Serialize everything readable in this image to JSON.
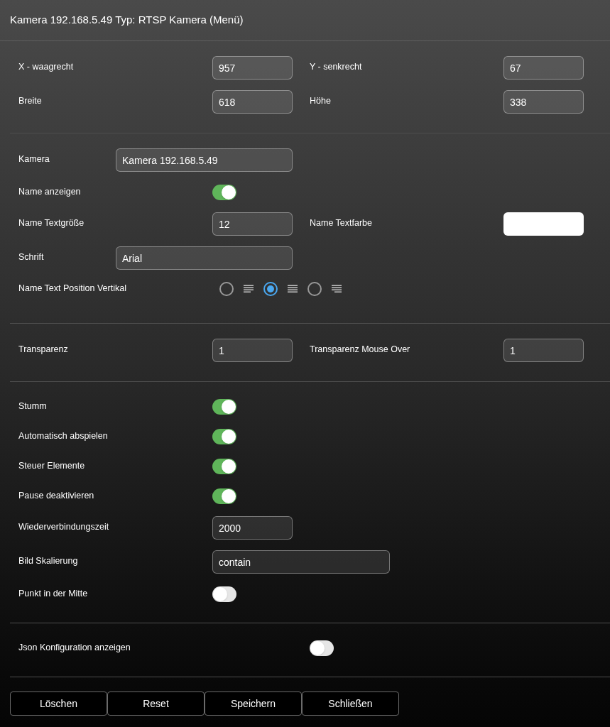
{
  "title": "Kamera 192.168.5.49 Typ: RTSP Kamera (Menü)",
  "sections": [
    {
      "rows": [
        [
          {
            "kind": "number",
            "label": "X - waagrecht",
            "value": "957"
          },
          {
            "kind": "number",
            "label": "Y - senkrecht",
            "value": "67"
          }
        ],
        [
          {
            "kind": "number",
            "label": "Breite",
            "value": "618"
          },
          {
            "kind": "number",
            "label": "Höhe",
            "value": "338"
          }
        ]
      ]
    },
    {
      "rows": [
        [
          {
            "kind": "text",
            "label": "Kamera",
            "value": "Kamera 192.168.5.49"
          }
        ],
        [
          {
            "kind": "toggle",
            "label": "Name anzeigen",
            "on": true
          }
        ],
        [
          {
            "kind": "number",
            "label": "Name Textgröße",
            "value": "12"
          },
          {
            "kind": "color",
            "label": "Name Textfarbe",
            "color": "#ffffff"
          }
        ],
        [
          {
            "kind": "text",
            "label": "Schrift",
            "value": "Arial"
          }
        ],
        [
          {
            "kind": "radio",
            "label": "Name Text Position Vertikal",
            "options": [
              {
                "selected": false
              },
              {
                "selected": true
              },
              {
                "selected": false
              }
            ]
          }
        ]
      ]
    },
    {
      "rows": [
        [
          {
            "kind": "number",
            "label": "Transparenz",
            "value": "1"
          },
          {
            "kind": "number",
            "label": "Transparenz Mouse Over",
            "value": "1"
          }
        ]
      ]
    },
    {
      "rows": [
        [
          {
            "kind": "toggle",
            "label": "Stumm",
            "on": true
          }
        ],
        [
          {
            "kind": "toggle",
            "label": "Automatisch abspielen",
            "on": true
          }
        ],
        [
          {
            "kind": "toggle",
            "label": "Steuer Elemente",
            "on": true
          }
        ],
        [
          {
            "kind": "toggle",
            "label": "Pause deaktivieren",
            "on": true
          }
        ],
        [
          {
            "kind": "number",
            "label": "Wiederverbindungszeit",
            "value": "2000"
          }
        ],
        [
          {
            "kind": "select",
            "label": "Bild Skalierung",
            "value": "contain"
          }
        ],
        [
          {
            "kind": "toggle",
            "label": "Punkt in der Mitte",
            "on": false
          }
        ]
      ]
    },
    {
      "rows": [
        [
          {
            "kind": "toggle_far",
            "label": "Json Konfiguration anzeigen",
            "on": false
          }
        ]
      ]
    }
  ],
  "buttons": [
    "Löschen",
    "Reset",
    "Speichern",
    "Schließen"
  ]
}
